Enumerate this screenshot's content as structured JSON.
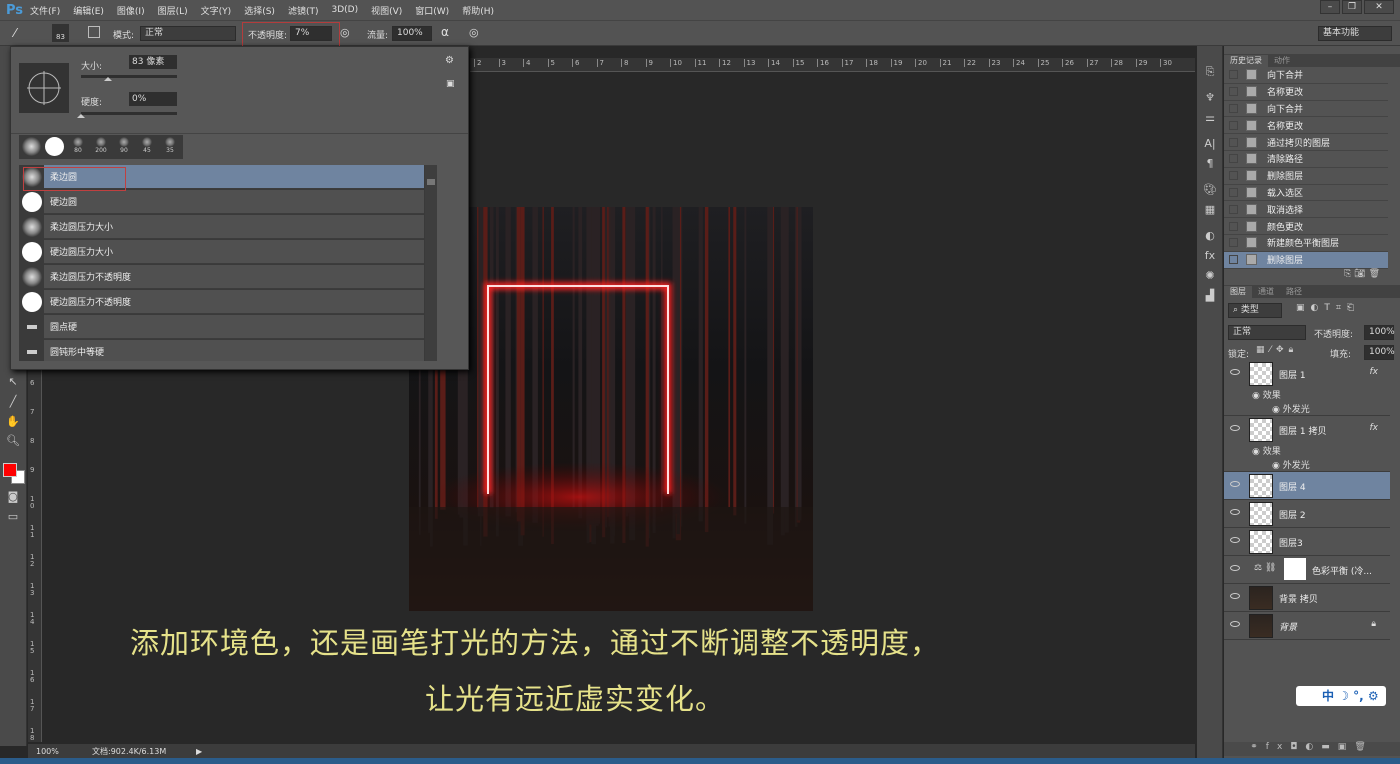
{
  "app": {
    "logo": "Ps"
  },
  "menu": [
    "文件(F)",
    "编辑(E)",
    "图像(I)",
    "图层(L)",
    "文字(Y)",
    "选择(S)",
    "滤镜(T)",
    "3D(D)",
    "视图(V)",
    "窗口(W)",
    "帮助(H)"
  ],
  "window_buttons": {
    "minimize": "–",
    "restore": "❐",
    "close": "✕"
  },
  "options": {
    "brush_size": "83",
    "mode_label": "模式:",
    "mode_value": "正常",
    "opacity_label": "不透明度:",
    "opacity_value": "7%",
    "flow_label": "流量:",
    "flow_value": "100%",
    "workspace": "基本功能"
  },
  "brush_panel": {
    "size_label": "大小:",
    "size_value": "83 像素",
    "hardness_label": "硬度:",
    "hardness_value": "0%",
    "size_slider": 0.28,
    "hardness_slider": 0.0,
    "presets": [
      "",
      "",
      "80",
      "200",
      "90",
      "45",
      "35"
    ],
    "brushes": [
      "柔边圆",
      "硬边圆",
      "柔边圆压力大小",
      "硬边圆压力大小",
      "柔边圆压力不透明度",
      "硬边圆压力不透明度",
      "圆点硬",
      "圆钝形中等硬"
    ],
    "selected": "柔边圆"
  },
  "colors": {
    "foreground": "#ff0000",
    "background": "#ffffff",
    "accent": "#6f84a0",
    "caption": "#e6e28a",
    "neon": "#ff2a2a"
  },
  "ruler_left": [
    "6",
    "7",
    "8",
    "9",
    "10",
    "11",
    "12",
    "13",
    "14",
    "15",
    "16",
    "17",
    "18"
  ],
  "ruler_top": [
    "2",
    "3",
    "4",
    "5",
    "6",
    "7",
    "8",
    "9",
    "10",
    "11",
    "12",
    "13",
    "14",
    "15",
    "16",
    "17",
    "18",
    "19",
    "20",
    "21",
    "22",
    "23",
    "24",
    "25",
    "26",
    "27",
    "28",
    "29",
    "30"
  ],
  "caption": {
    "line1": "添加环境色，还是画笔打光的方法，通过不断调整不透明度，",
    "line2": "让光有远近虚实变化。"
  },
  "status": {
    "zoom": "100%",
    "doc": "文档:902.4K/6.13M"
  },
  "history": {
    "tabs": [
      "历史记录",
      "动作"
    ],
    "items": [
      "向下合并",
      "名称更改",
      "向下合并",
      "名称更改",
      "通过拷贝的图层",
      "清除路径",
      "删除图层",
      "载入选区",
      "取消选择",
      "颜色更改",
      "新建颜色平衡图层",
      "删除图层"
    ],
    "selected_index": 11
  },
  "layers": {
    "tabs": [
      "图层",
      "通道",
      "路径"
    ],
    "filter": "类型",
    "blend": "正常",
    "opacity_label": "不透明度:",
    "opacity": "100%",
    "lock_label": "锁定:",
    "fill_label": "填充:",
    "fill": "100%",
    "items": [
      {
        "name": "图层 1",
        "fx": "fx",
        "effects": "效果",
        "effect": "外发光"
      },
      {
        "name": "图层 1 拷贝",
        "fx": "fx",
        "effects": "效果",
        "effect": "外发光"
      },
      {
        "name": "图层 4"
      },
      {
        "name": "图层 2"
      },
      {
        "name": "图层3"
      },
      {
        "name": "色彩平衡 (冷..."
      },
      {
        "name": "背景 拷贝"
      },
      {
        "name": "背景"
      }
    ],
    "selected": "图层 4"
  },
  "ime": {
    "label": "中"
  }
}
